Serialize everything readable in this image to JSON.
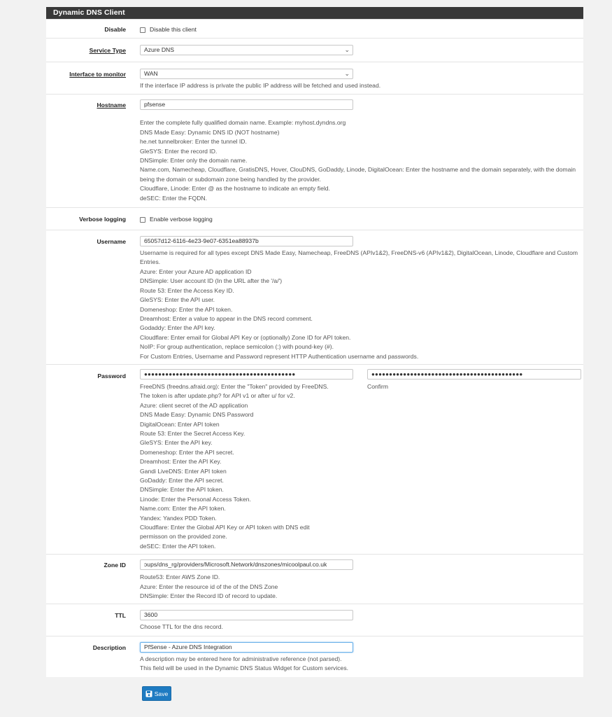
{
  "panel_title": "Dynamic DNS Client",
  "disable": {
    "label": "Disable",
    "checkbox_label": "Disable this client"
  },
  "service_type": {
    "label": "Service Type",
    "value": "Azure DNS"
  },
  "interface": {
    "label": "Interface to monitor",
    "value": "WAN",
    "help": "If the interface IP address is private the public IP address will be fetched and used instead."
  },
  "hostname": {
    "label": "Hostname",
    "value": "pfsense",
    "help": [
      "Enter the complete fully qualified domain name. Example: myhost.dyndns.org",
      "DNS Made Easy: Dynamic DNS ID (NOT hostname)",
      "he.net tunnelbroker: Enter the tunnel ID.",
      "GleSYS: Enter the record ID.",
      "DNSimple: Enter only the domain name.",
      "Name.com, Namecheap, Cloudflare, GratisDNS, Hover, ClouDNS, GoDaddy, Linode, DigitalOcean: Enter the hostname and the domain separately, with the domain being the domain or subdomain zone being handled by the provider.",
      "Cloudflare, Linode: Enter @ as the hostname to indicate an empty field.",
      "deSEC: Enter the FQDN."
    ]
  },
  "verbose": {
    "label": "Verbose logging",
    "checkbox_label": "Enable verbose logging"
  },
  "username": {
    "label": "Username",
    "value": "65057d12-6116-4e23-9e07-6351ea88937b",
    "help": [
      "Username is required for all types except DNS Made Easy, Namecheap, FreeDNS (APIv1&2), FreeDNS-v6 (APIv1&2), DigitalOcean, Linode, Cloudflare and Custom Entries.",
      "Azure: Enter your Azure AD application ID",
      "DNSimple: User account ID (In the URL after the '/a/')",
      "Route 53: Enter the Access Key ID.",
      "GleSYS: Enter the API user.",
      "Domeneshop: Enter the API token.",
      "Dreamhost: Enter a value to appear in the DNS record comment.",
      "Godaddy: Enter the API key.",
      "Cloudflare: Enter email for Global API Key or (optionally) Zone ID for API token.",
      "NoIP: For group authentication, replace semicolon (:) with pound-key (#).",
      "For Custom Entries, Username and Password represent HTTP Authentication username and passwords."
    ]
  },
  "password": {
    "label": "Password",
    "value": "●●●●●●●●●●●●●●●●●●●●●●●●●●●●●●●●●●●●●●●●●●●",
    "confirm_value": "●●●●●●●●●●●●●●●●●●●●●●●●●●●●●●●●●●●●●●●●●●●",
    "confirm_label": "Confirm",
    "help": [
      "FreeDNS (freedns.afraid.org): Enter the \"Token\" provided by FreeDNS.",
      "The token is after update.php? for API v1 or after u/ for v2.",
      "Azure: client secret of the AD application",
      "DNS Made Easy: Dynamic DNS Password",
      "DigitalOcean: Enter API token",
      "Route 53: Enter the Secret Access Key.",
      "GleSYS: Enter the API key.",
      "Domeneshop: Enter the API secret.",
      "Dreamhost: Enter the API Key.",
      "Gandi LiveDNS: Enter API token",
      "GoDaddy: Enter the API secret.",
      "DNSimple: Enter the API token.",
      "Linode: Enter the Personal Access Token.",
      "Name.com: Enter the API token.",
      "Yandex: Yandex PDD Token.",
      "Cloudflare: Enter the Global API Key or API token with DNS edit",
      "permisson on the provided zone.",
      "deSEC: Enter the API token."
    ]
  },
  "zone_id": {
    "label": "Zone ID",
    "value": "ɔups/dns_rg/providers/Microsoft.Network/dnszones/micoolpaul.co.uk",
    "help": [
      "Route53: Enter AWS Zone ID.",
      "Azure: Enter the resource id of the of the DNS Zone",
      "DNSimple: Enter the Record ID of record to update."
    ]
  },
  "ttl": {
    "label": "TTL",
    "value": "3600",
    "help": "Choose TTL for the dns record."
  },
  "description": {
    "label": "Description",
    "value": "PfSense - Azure DNS Integration",
    "help": [
      "A description may be entered here for administrative reference (not parsed).",
      "This field will be used in the Dynamic DNS Status Widget for Custom services."
    ]
  },
  "save_label": "Save",
  "colors": {
    "heading_bg": "#393939",
    "button_bg": "#1e7bc2",
    "focus_border": "#66afe9"
  }
}
